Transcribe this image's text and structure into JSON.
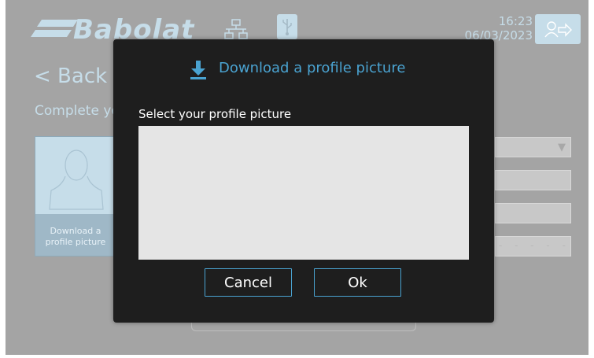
{
  "header": {
    "brand": "Babolat",
    "icons": {
      "network": "network-icon",
      "usb": "usb-icon",
      "logout": "logout-icon"
    },
    "clock": {
      "time": "16:23",
      "date": "06/03/2023"
    }
  },
  "page": {
    "back_label": "< Back",
    "title": "Complete your profile",
    "profile_card_caption": "Download a profile picture"
  },
  "dialog": {
    "title": "Download a profile picture",
    "icon": "download-icon",
    "select_label": "Select your profile picture",
    "cancel_label": "Cancel",
    "ok_label": "Ok"
  },
  "colors": {
    "accent": "#4aa3d1",
    "background_dim": "#a4a4a4",
    "dialog_bg": "#1e1e1e",
    "list_bg": "#e5e5e5"
  }
}
